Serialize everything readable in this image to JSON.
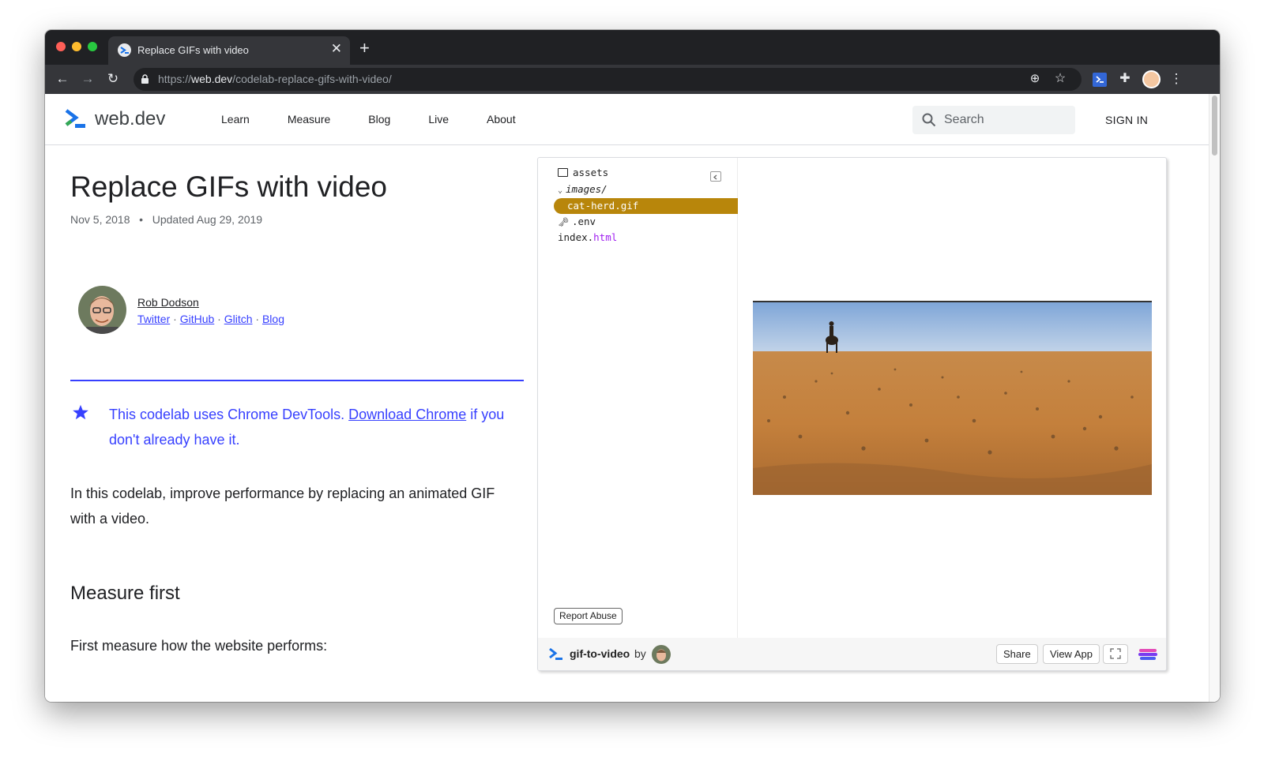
{
  "browser": {
    "tab_title": "Replace GIFs with video",
    "url_scheme": "https://",
    "url_host": "web.dev",
    "url_path": "/codelab-replace-gifs-with-video/",
    "icons": [
      "back-icon",
      "forward-icon",
      "reload-icon",
      "lock-icon",
      "install-icon",
      "bookmark-star-icon",
      "extension-icon",
      "puzzle-icon",
      "profile-icon",
      "menu-icon"
    ]
  },
  "site": {
    "logo_text": "web.dev",
    "nav": [
      "Learn",
      "Measure",
      "Blog",
      "Live",
      "About"
    ],
    "search_placeholder": "Search",
    "signin": "SIGN IN"
  },
  "article": {
    "title": "Replace GIFs with video",
    "date": "Nov 5, 2018",
    "updated": "Updated Aug 29, 2019",
    "author": {
      "name": "Rob Dodson",
      "links": [
        "Twitter",
        "GitHub",
        "Glitch",
        "Blog"
      ]
    },
    "callout": {
      "pre": "This codelab uses Chrome DevTools. ",
      "link": "Download Chrome",
      "post": " if you don't already have it."
    },
    "intro": "In this codelab, improve performance by replacing an animated GIF with a video.",
    "section_heading": "Measure first",
    "section_para": "First measure how the website performs:"
  },
  "embed": {
    "files": {
      "assets": "assets",
      "images_dir": "images/",
      "selected_file": "cat-herd.gif",
      "env": ".env",
      "index_base": "index.",
      "index_ext": "html"
    },
    "report_abuse": "Report Abuse",
    "project_name": "gif-to-video",
    "by": "by",
    "buttons": {
      "share": "Share",
      "view_app": "View App"
    },
    "colors": {
      "selected": "#b8860b",
      "html_ext": "#a020f0"
    }
  },
  "colors": {
    "accent": "#3740ff",
    "tab_bar": "#202124",
    "toolbar": "#35363a"
  }
}
